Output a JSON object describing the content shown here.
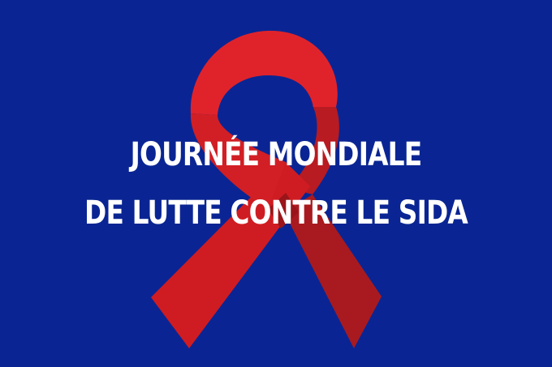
{
  "colors": {
    "background": "#0a2593",
    "ribbon_main": "#e0232b",
    "ribbon_mid": "#cf1c22",
    "ribbon_shade": "#a81a1f",
    "text": "#ffffff"
  },
  "banner": {
    "title_line_1": "JOURNÉE MONDIALE",
    "title_line_2": "DE LUTTE CONTRE LE SIDA"
  },
  "icons": {
    "ribbon": "red-awareness-ribbon-icon"
  }
}
